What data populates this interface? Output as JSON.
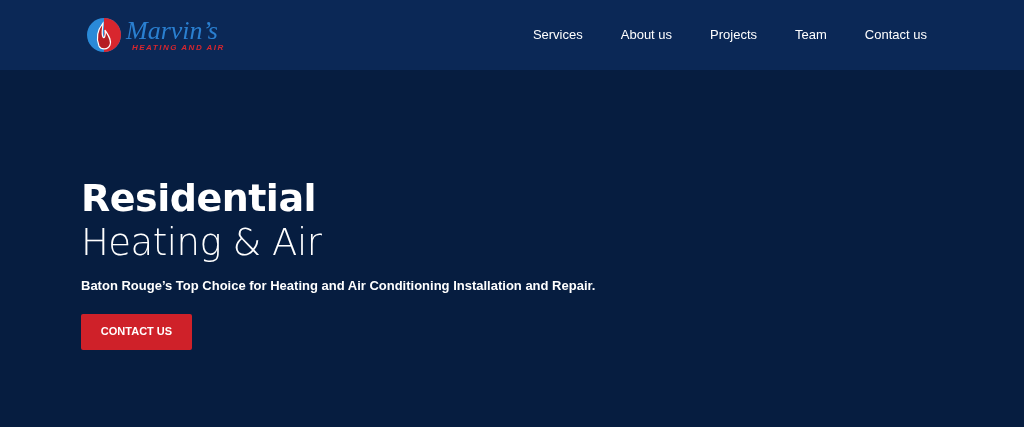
{
  "logo": {
    "name": "Marvin’s",
    "tagline": "HEATING AND AIR"
  },
  "nav": [
    {
      "label": "Services"
    },
    {
      "label": "About us"
    },
    {
      "label": "Projects"
    },
    {
      "label": "Team"
    },
    {
      "label": "Contact us"
    }
  ],
  "hero": {
    "title_bold": "Residential",
    "title_light": "Heating & Air",
    "subtitle": "Baton Rouge’s Top Choice for Heating and Air Conditioning Installation and Repair.",
    "button": "CONTACT US"
  }
}
